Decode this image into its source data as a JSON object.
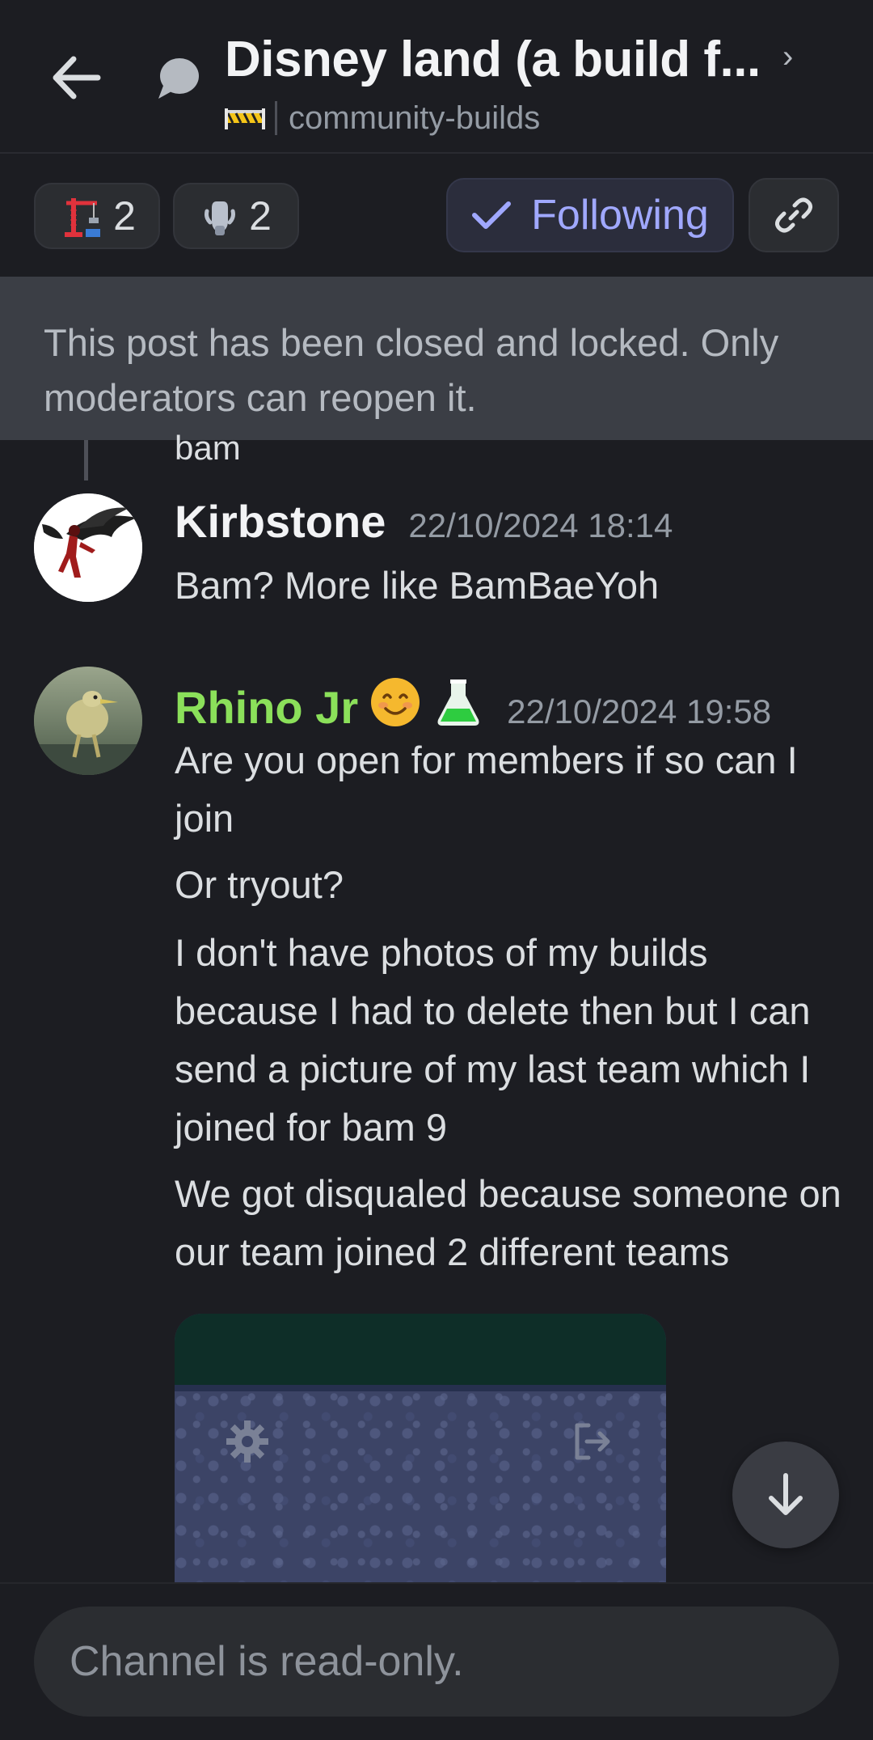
{
  "header": {
    "title": "Disney land (a build f...",
    "channel_emoji": "construction-tape-emoji",
    "channel": "community-builds"
  },
  "tags": [
    {
      "icon": "crane-emoji",
      "count": "2"
    },
    {
      "icon": "hand-emoji",
      "count": "2"
    }
  ],
  "follow_label": "Following",
  "locked_notice": "This post has been closed and locked. Only moderators can reopen it.",
  "reply_peek": "bam",
  "messages": [
    {
      "author": "Kirbstone",
      "timestamp": "22/10/2024 18:14",
      "lines": [
        "Bam? More like BamBaeYoh"
      ]
    },
    {
      "author": "Rhino Jr",
      "badges": [
        "smiling-face-emoji",
        "flask-emoji"
      ],
      "timestamp": "22/10/2024 19:58",
      "lines": [
        "Are you open for members if so can I join",
        "Or tryout?",
        "I don't have photos of my builds because I had to delete then but I can send a picture of my last team which I joined for bam 9",
        "We got disqualed because someone on our team joined 2 different teams"
      ]
    }
  ],
  "composer": {
    "placeholder": "Channel is read-only."
  },
  "colors": {
    "background": "#1c1d22",
    "accent": "#a0a8ff",
    "rhino_name": "#8be05a",
    "locked_banner": "#3b3e45"
  }
}
